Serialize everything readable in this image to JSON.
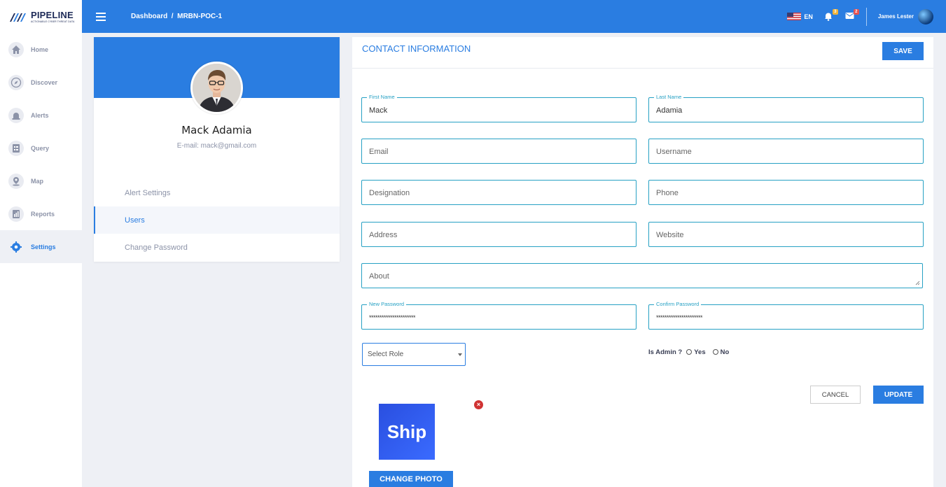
{
  "app": {
    "logo_name": "PIPELINE",
    "logo_tagline": "ACTIONABLE CYBER THREAT DATA"
  },
  "sidebar": {
    "items": [
      {
        "label": "Home",
        "icon": "home-icon"
      },
      {
        "label": "Discover",
        "icon": "compass-icon"
      },
      {
        "label": "Alerts",
        "icon": "alarm-icon"
      },
      {
        "label": "Query",
        "icon": "query-icon"
      },
      {
        "label": "Map",
        "icon": "map-pin-icon"
      },
      {
        "label": "Reports",
        "icon": "reports-icon"
      },
      {
        "label": "Settings",
        "icon": "gear-icon",
        "active": true
      }
    ]
  },
  "header": {
    "breadcrumb": "Dashboard  /  MRBN-POC-1",
    "language": "EN",
    "notifications_count": "3",
    "messages_count": "2",
    "user_name": "James Lester"
  },
  "profile": {
    "name": "Mack Adamia",
    "email": "E-mail: mack@gmail.com",
    "menu": [
      "Alert Settings",
      "Users",
      "Change Password"
    ],
    "active_menu": "Users"
  },
  "contact": {
    "title": "CONTACT INFORMATION",
    "save_label": "SAVE",
    "first_name_label": "First Name",
    "first_name_value": "Mack",
    "last_name_label": "Last Name",
    "last_name_value": "Adamia",
    "email_placeholder": "Email",
    "username_placeholder": "Username",
    "designation_placeholder": "Designation",
    "phone_placeholder": "Phone",
    "address_placeholder": "Address",
    "website_placeholder": "Website",
    "about_placeholder": "About",
    "new_password_label": "New Password",
    "new_password_value": "**********************",
    "confirm_password_label": "Confirm Password",
    "confirm_password_value": "**********************",
    "role_value": "Select Role",
    "is_admin_label": "Is Admin ?",
    "yes_label": "Yes",
    "no_label": "No",
    "cancel_label": "CANCEL",
    "update_label": "UPDATE",
    "photo_text": "Ship",
    "change_photo_label": "CHANGE PHOTO"
  },
  "colors": {
    "primary": "#2a7de1",
    "field_border": "#27a1c4",
    "sidebar_text": "#8c93a8",
    "remove": "#d03333"
  }
}
